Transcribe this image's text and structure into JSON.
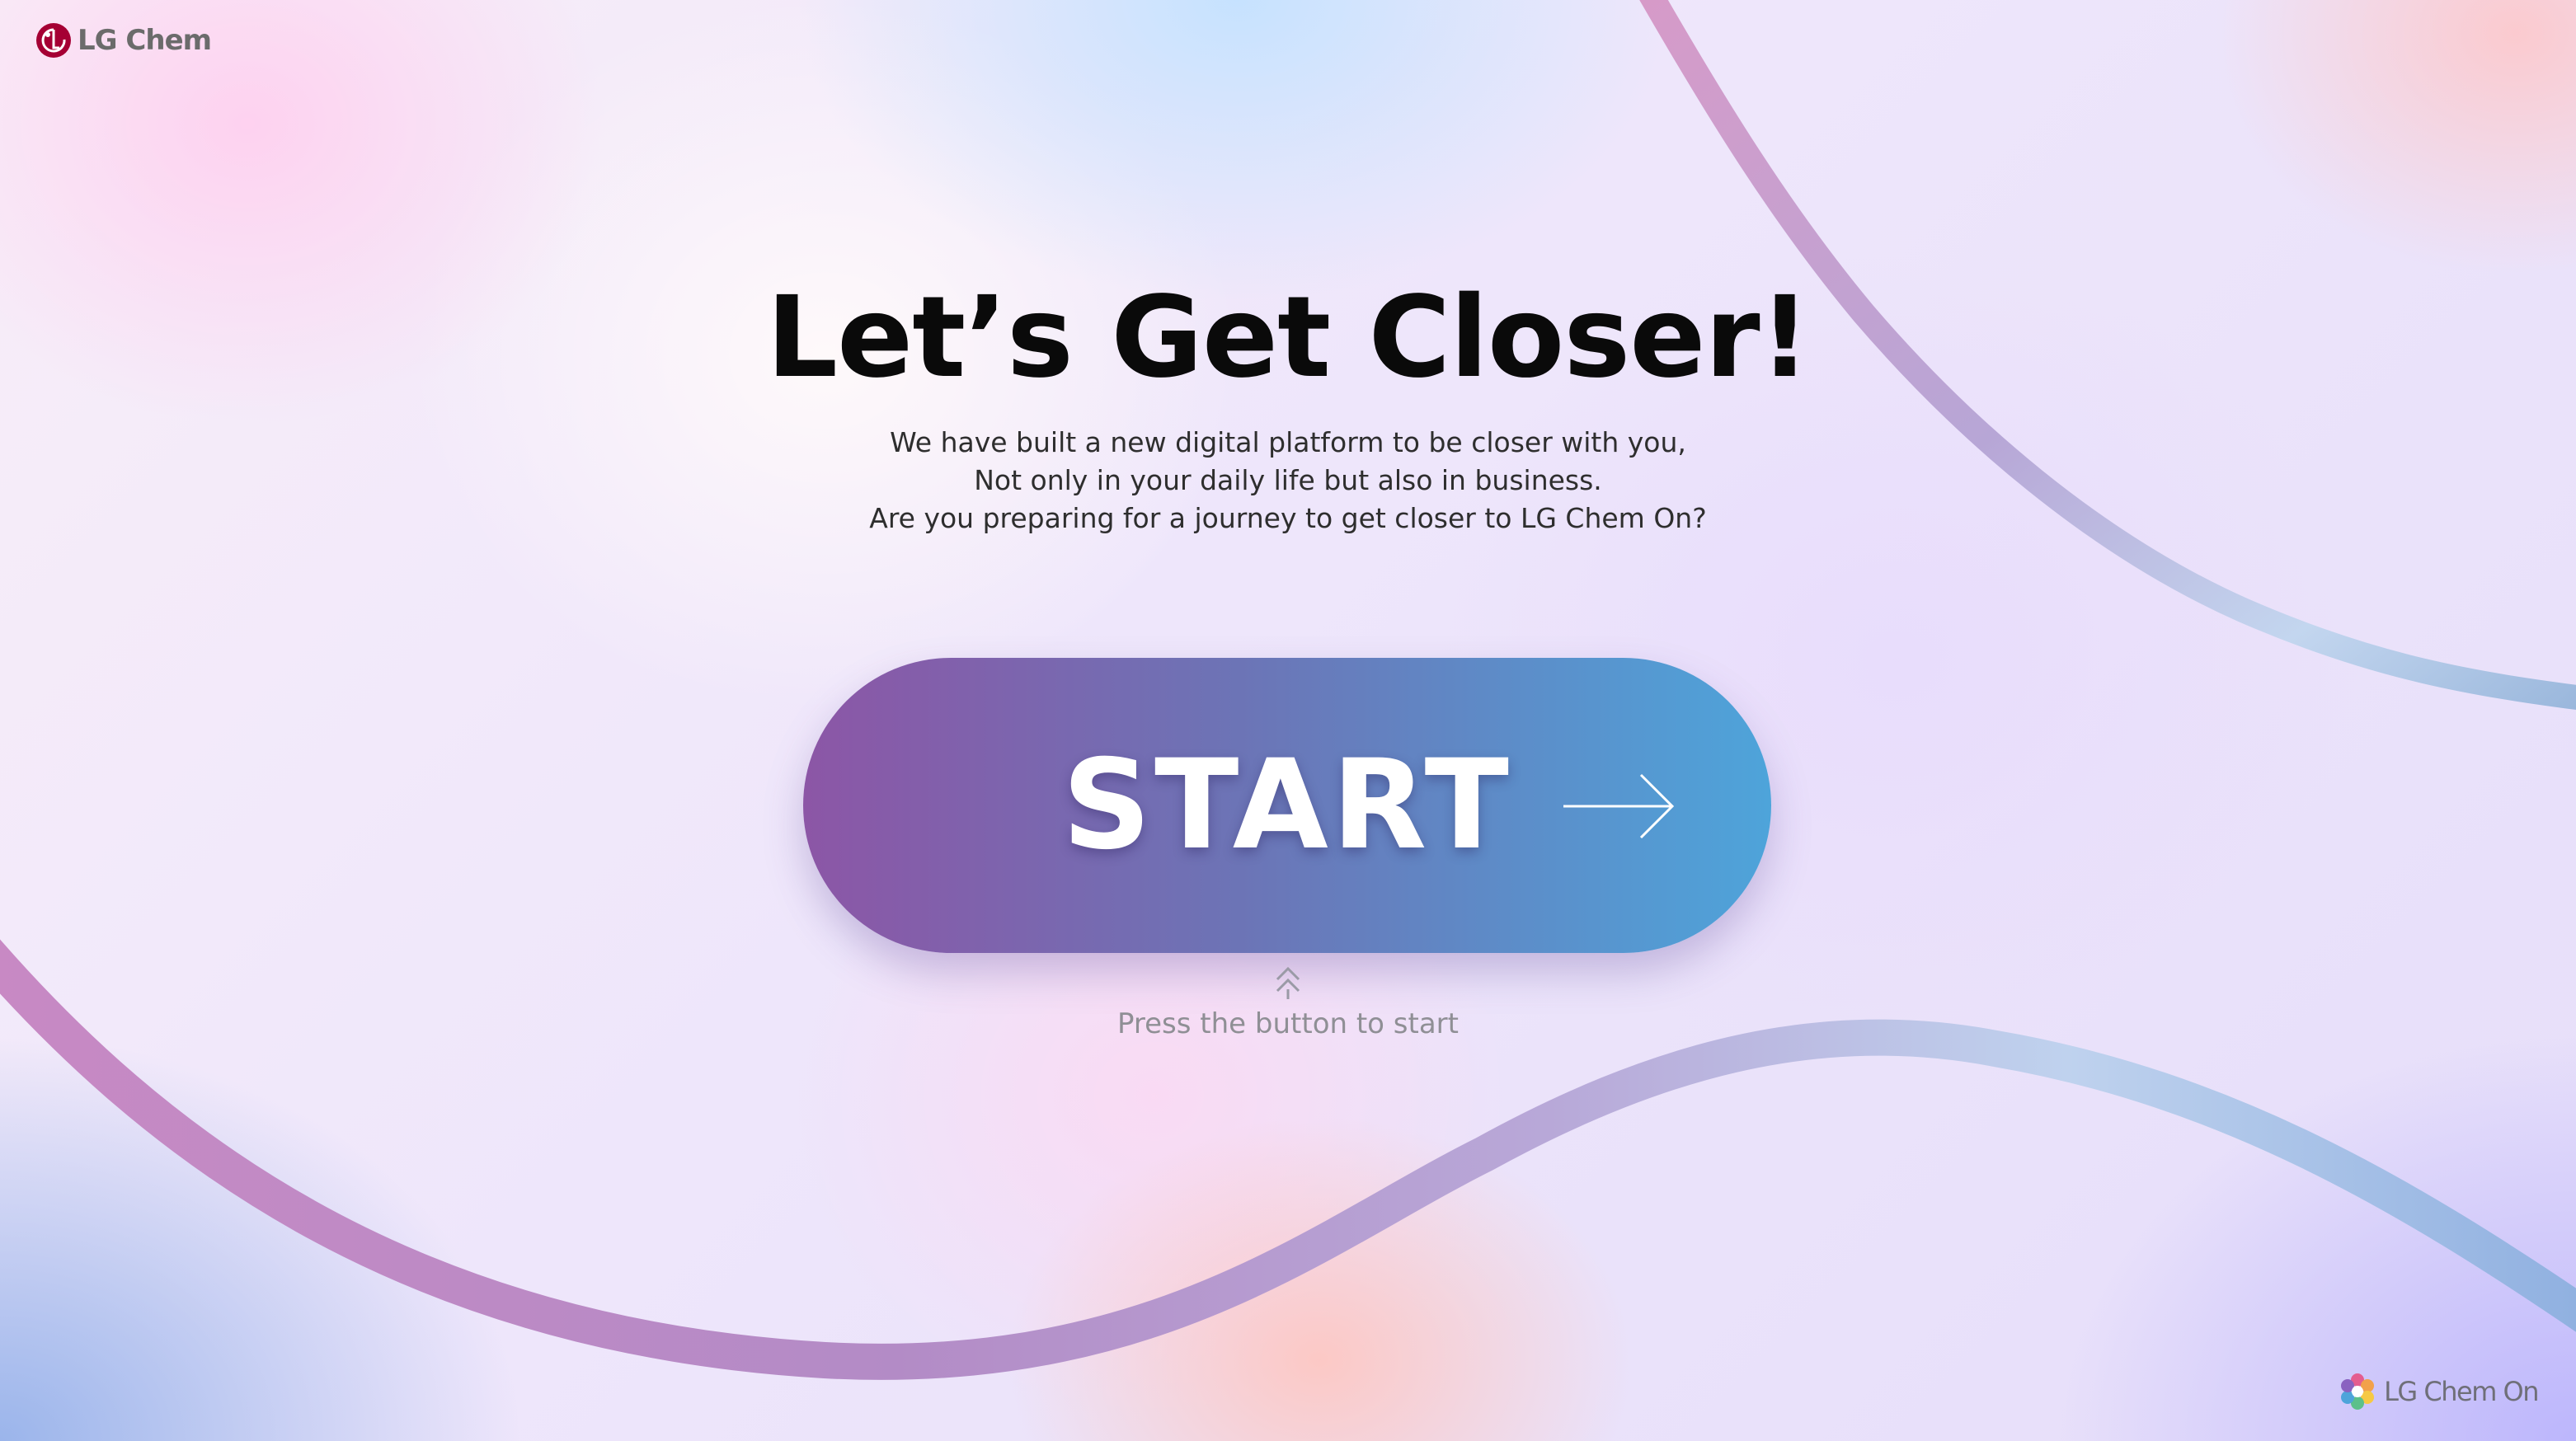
{
  "brand": {
    "corp_logo_text": "LG Chem",
    "platform_logo_text": "LG Chem On"
  },
  "hero": {
    "headline": "Let’s Get Closer!",
    "intro_lines": [
      "We have built a new digital platform to be closer with you,",
      "Not only in your daily life but also in business.",
      "Are you preparing for a journey to get closer to LG Chem On?"
    ]
  },
  "start_button": {
    "label": "START",
    "icon": "arrow-right-icon"
  },
  "hint": {
    "icon": "double-chevron-up-icon",
    "text": "Press the button to start"
  },
  "colors": {
    "brand_red": "#a50034",
    "button_gradient_start": "#8c56a6",
    "button_gradient_end": "#4ea4da",
    "headline": "#0a0a0a",
    "hint_text": "#8f8f95"
  }
}
